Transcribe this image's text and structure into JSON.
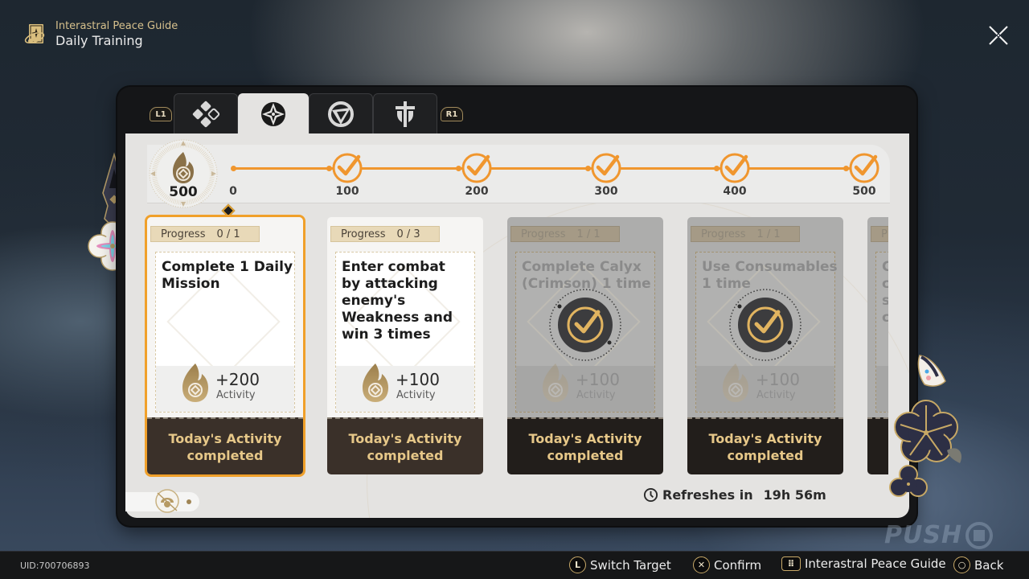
{
  "header": {
    "subtitle": "Interastral Peace Guide",
    "title": "Daily Training",
    "icon": "guide-book-icon"
  },
  "close_icon": "close-icon",
  "tabs": {
    "prev_shoulder": "L1",
    "next_shoulder": "R1",
    "items": [
      {
        "name": "operation-briefing",
        "icon": "briefing-icon",
        "active": false
      },
      {
        "name": "daily-training",
        "icon": "daily-training-icon",
        "active": true
      },
      {
        "name": "survival-guide",
        "icon": "survival-guide-icon",
        "active": false
      },
      {
        "name": "treasures-lightward",
        "icon": "treasures-icon",
        "active": false
      }
    ]
  },
  "activity": {
    "current": "500",
    "milestones": [
      {
        "label": "0",
        "claimed": false
      },
      {
        "label": "100",
        "claimed": true
      },
      {
        "label": "200",
        "claimed": true
      },
      {
        "label": "300",
        "claimed": true
      },
      {
        "label": "400",
        "claimed": true
      },
      {
        "label": "500",
        "claimed": true
      }
    ]
  },
  "cards": [
    {
      "progress_label": "Progress",
      "progress": "0 / 1",
      "task": "Complete 1 Daily Mission",
      "reward": "+200",
      "reward_unit": "Activity",
      "footer": "Today's Activity completed",
      "completed": false,
      "selected": true
    },
    {
      "progress_label": "Progress",
      "progress": "0 / 3",
      "task": "Enter combat by attacking enemy's Weakness and win 3 times",
      "reward": "+100",
      "reward_unit": "Activity",
      "footer": "Today's Activity completed",
      "completed": false,
      "selected": false
    },
    {
      "progress_label": "Progress",
      "progress": "1 / 1",
      "task": "Complete Calyx (Crimson) 1 time",
      "reward": "+100",
      "reward_unit": "Activity",
      "footer": "Today's Activity completed",
      "completed": true,
      "selected": false
    },
    {
      "progress_label": "Progress",
      "progress": "1 / 1",
      "task": "Use Consumables 1 time",
      "reward": "+100",
      "reward_unit": "Activity",
      "footer": "Today's Activity completed",
      "completed": true,
      "selected": false
    },
    {
      "progress_label": "P",
      "progress": "",
      "task": "C c s c",
      "reward": "",
      "reward_unit": "",
      "footer": "",
      "completed": true,
      "selected": false
    }
  ],
  "refresh": {
    "label": "Refreshes in",
    "time": "19h 56m"
  },
  "footer": {
    "uid": "UID:700706893",
    "hints": [
      {
        "button": "L",
        "label": "Switch Target"
      },
      {
        "button": "✕",
        "label": "Confirm"
      },
      {
        "button": "⠿",
        "label": "Interastral Peace Guide"
      },
      {
        "button": "○",
        "label": "Back"
      }
    ]
  },
  "watermark": "PUSH",
  "colors": {
    "accent_orange": "#f0962e",
    "gold_text": "#e6c788",
    "card_footer": "#3a3029",
    "header_gold": "#d6c08c"
  }
}
